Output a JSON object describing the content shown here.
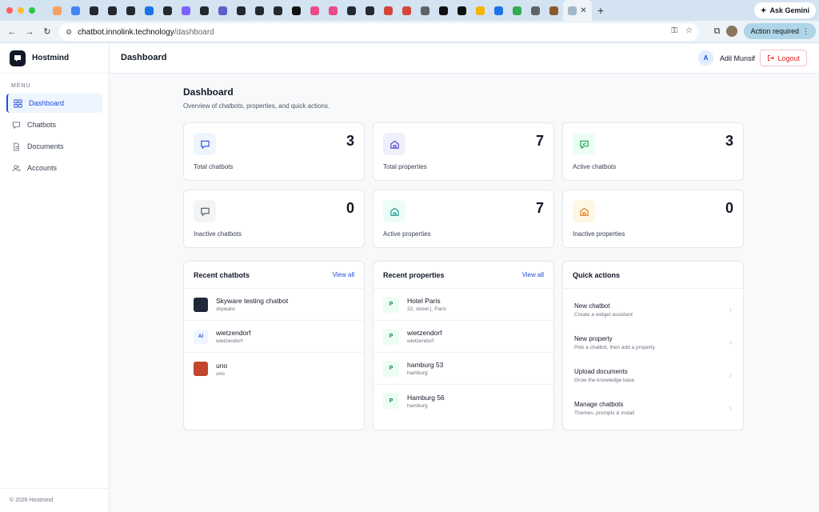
{
  "browser": {
    "url_host": "chatbot.innolink.technology",
    "url_path": "/dashboard",
    "ask_gemini": "Ask Gemini",
    "action_required": "Action required",
    "tab_favicon_colors": [
      "#f4a261",
      "#4285f4",
      "#24292f",
      "#24292f",
      "#24292f",
      "#1a73e8",
      "#24292f",
      "#7b61ff",
      "#24292f",
      "#5b5fc7",
      "#24292f",
      "#24292f",
      "#24292f",
      "#111111",
      "#ea4c89",
      "#ea4c89",
      "#24292f",
      "#24292f",
      "#d44638",
      "#d44638",
      "#5f6368",
      "#111111",
      "#111111",
      "#f4b400",
      "#1a73e8",
      "#34a853",
      "#5f6368",
      "#8b5a2b"
    ]
  },
  "app": {
    "brand": "Hostmind",
    "menu_label": "MENU",
    "nav": [
      {
        "label": "Dashboard",
        "icon": "grid-icon",
        "active": true
      },
      {
        "label": "Chatbots",
        "icon": "chat-icon",
        "active": false
      },
      {
        "label": "Documents",
        "icon": "document-icon",
        "active": false
      },
      {
        "label": "Accounts",
        "icon": "users-icon",
        "active": false
      }
    ],
    "footer": "© 2026 Hostmind",
    "header_title": "Dashboard",
    "user": {
      "initial": "A",
      "name": "Adil Munsif"
    },
    "logout": "Logout"
  },
  "dashboard": {
    "title": "Dashboard",
    "subtitle": "Overview of chatbots, properties, and quick actions.",
    "stats": [
      {
        "label": "Total chatbots",
        "value": "3",
        "icon": "chat-icon",
        "color": "#1d4ed8",
        "bg": "#eff5ff"
      },
      {
        "label": "Total properties",
        "value": "7",
        "icon": "home-icon",
        "color": "#4338ca",
        "bg": "#eef0fb"
      },
      {
        "label": "Active chatbots",
        "value": "3",
        "icon": "chat-check-icon",
        "color": "#16a34a",
        "bg": "#ecfdf3"
      },
      {
        "label": "Inactive chatbots",
        "value": "0",
        "icon": "chat-icon",
        "color": "#4b5563",
        "bg": "#f3f4f6"
      },
      {
        "label": "Active properties",
        "value": "7",
        "icon": "home-icon",
        "color": "#0d9488",
        "bg": "#ecfdf8"
      },
      {
        "label": "Inactive properties",
        "value": "0",
        "icon": "home-icon",
        "color": "#d97706",
        "bg": "#fff7e6"
      }
    ],
    "recent_chatbots": {
      "title": "Recent chatbots",
      "view_all": "View all",
      "items": [
        {
          "name": "Skyware testing chatbot",
          "sub": "skyware",
          "thumb": "",
          "thumb_bg": "#1f2937",
          "thumb_fg": "#ffffff"
        },
        {
          "name": "wietzendorf",
          "sub": "wietzendorf",
          "thumb": "AI",
          "thumb_bg": "#eff5ff",
          "thumb_fg": "#1d4ed8"
        },
        {
          "name": "uno",
          "sub": "uno",
          "thumb": "",
          "thumb_bg": "#c2452d",
          "thumb_fg": "#ffffff"
        }
      ]
    },
    "recent_properties": {
      "title": "Recent properties",
      "view_all": "View all",
      "items": [
        {
          "badge": "P",
          "name": "Hotel Paris",
          "sub": "22, street |, Paris"
        },
        {
          "badge": "P",
          "name": "wietzendorf",
          "sub": "wietzendorf"
        },
        {
          "badge": "P",
          "name": "hamburg 53",
          "sub": "hamburg"
        },
        {
          "badge": "P",
          "name": "Hamburg 56",
          "sub": "hamburg"
        }
      ]
    },
    "quick_actions": {
      "title": "Quick actions",
      "items": [
        {
          "name": "New chatbot",
          "sub": "Create a widget assistant"
        },
        {
          "name": "New property",
          "sub": "Pick a chatbot, then add a property"
        },
        {
          "name": "Upload documents",
          "sub": "Grow the knowledge base"
        },
        {
          "name": "Manage chatbots",
          "sub": "Themes, prompts & install"
        }
      ]
    }
  }
}
